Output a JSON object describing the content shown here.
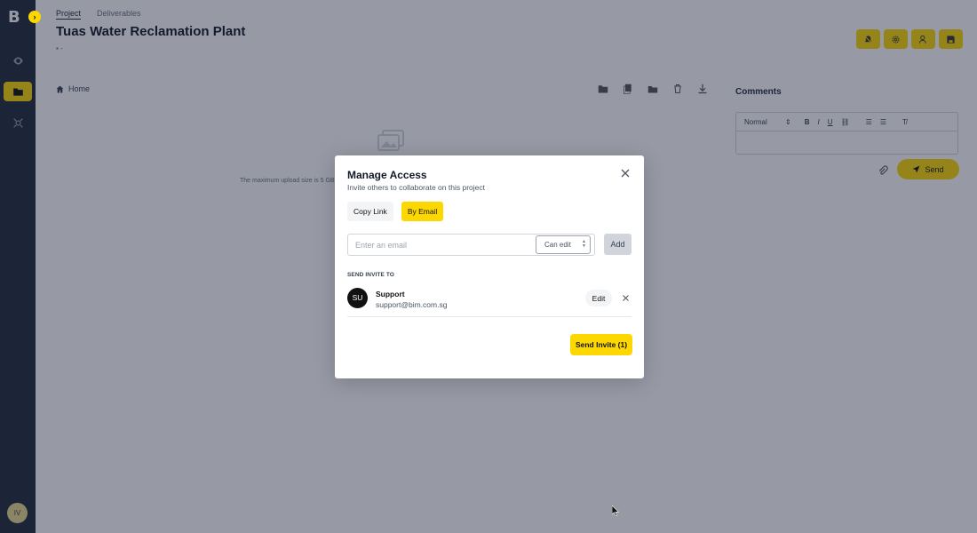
{
  "app": {
    "logo_text": "B",
    "collapse_icon": "chevron-right-icon",
    "user_initials": "IV"
  },
  "header": {
    "tabs": [
      {
        "label": "Project",
        "active": true
      },
      {
        "label": "Deliverables",
        "active": false
      }
    ],
    "title": "Tuas Water Reclamation Plant",
    "subtitle": "-",
    "actions": [
      "bell-off-icon",
      "gear-icon",
      "user-add-icon",
      "save-icon"
    ]
  },
  "files": {
    "breadcrumb_home": "Home",
    "upload_note": "The maximum upload size is 5 GB"
  },
  "comments": {
    "title": "Comments",
    "format_select": "Normal",
    "send_label": "Send"
  },
  "modal": {
    "title": "Manage Access",
    "subtitle": "Invite others to collaborate on this project",
    "tabs": {
      "copy_link": "Copy Link",
      "by_email": "By Email"
    },
    "email_placeholder": "Enter an email",
    "permission": "Can edit",
    "add_label": "Add",
    "section_label": "SEND INVITE TO",
    "invitees": [
      {
        "initials": "SU",
        "name": "Support",
        "email": "support@bim.com.sg",
        "edit_label": "Edit"
      }
    ],
    "send_label": "Send Invite (1)"
  },
  "colors": {
    "accent": "#fcd800",
    "sidebar": "#1f2937",
    "overlay": "rgba(25,30,55,0.45)"
  }
}
